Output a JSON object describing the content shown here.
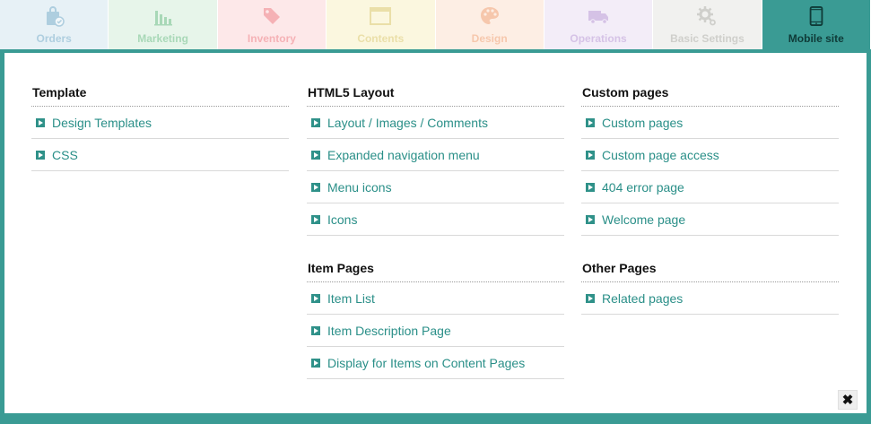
{
  "tabs": [
    {
      "label": "Orders",
      "icon": "orders-bag-icon",
      "bg": "#e7f1f6",
      "color": "#6aa4c4"
    },
    {
      "label": "Marketing",
      "icon": "bar-chart-icon",
      "bg": "#e7f5ea",
      "color": "#5eb67b"
    },
    {
      "label": "Inventory",
      "icon": "price-tag-icon",
      "bg": "#fde8e9",
      "color": "#ec6f78"
    },
    {
      "label": "Contents",
      "icon": "window-icon",
      "bg": "#fbf7df",
      "color": "#d6c367"
    },
    {
      "label": "Design",
      "icon": "palette-icon",
      "bg": "#fdeee4",
      "color": "#ef9a6a"
    },
    {
      "label": "Operations",
      "icon": "truck-icon",
      "bg": "#f3edf8",
      "color": "#b28fd1"
    },
    {
      "label": "Basic Settings",
      "icon": "gear-icon",
      "bg": "#f1f1ef",
      "color": "#a6a6a0"
    },
    {
      "label": "Mobile site",
      "icon": "mobile-phone-icon",
      "bg": "#3a9b94",
      "color": "#0f3b38"
    }
  ],
  "columns": [
    {
      "sections": [
        {
          "title": "Template",
          "items": [
            "Design Templates",
            "CSS"
          ]
        }
      ]
    },
    {
      "sections": [
        {
          "title": "HTML5 Layout",
          "items": [
            "Layout / Images / Comments",
            "Expanded navigation menu",
            "Menu icons",
            "Icons"
          ]
        },
        {
          "title": "Item Pages",
          "items": [
            "Item List",
            "Item Description Page",
            "Display for Items on Content Pages"
          ]
        }
      ]
    },
    {
      "sections": [
        {
          "title": "Custom pages",
          "items": [
            "Custom pages",
            "Custom page access",
            "404 error page",
            "Welcome page"
          ]
        },
        {
          "title": "Other Pages",
          "items": [
            "Related pages"
          ]
        }
      ]
    }
  ],
  "close": {
    "label": "✖"
  },
  "colors": {
    "accent": "#3a9b94",
    "link": "#2a8f88"
  }
}
